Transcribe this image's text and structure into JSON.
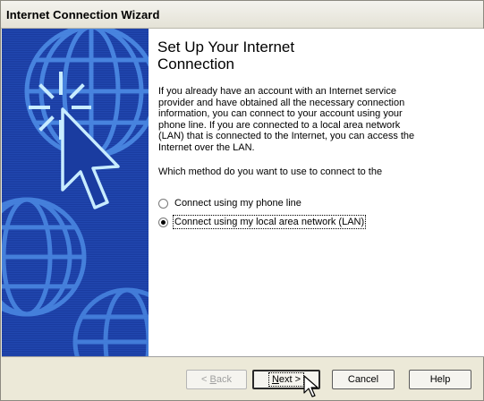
{
  "window": {
    "title": "Internet Connection Wizard"
  },
  "page": {
    "heading_line1": "Set Up Your Internet",
    "heading_line2": "Connection",
    "intro_lines": [
      "If you already have an account with an Internet service",
      "provider and have obtained all the necessary connection",
      "information, you can connect to your account using your",
      "phone line. If you are connected to a local area network",
      "(LAN) that is connected to the Internet, you can access the",
      "Internet over the LAN."
    ],
    "question": "Which method do you want to use to connect to the",
    "options": [
      {
        "label": "Connect using my phone line",
        "selected": false
      },
      {
        "label": "Connect using my local area network (LAN)",
        "selected": true
      }
    ]
  },
  "buttons": {
    "back_prefix": "< ",
    "back_mnemonic": "B",
    "back_rest": "ack",
    "next_mnemonic": "N",
    "next_rest": "ext >",
    "cancel": "Cancel",
    "help": "Help"
  },
  "colors": {
    "banner": "#1a3ca0",
    "banner_art": "#4f8fe8",
    "accent_lines": "#8fd0ff"
  }
}
